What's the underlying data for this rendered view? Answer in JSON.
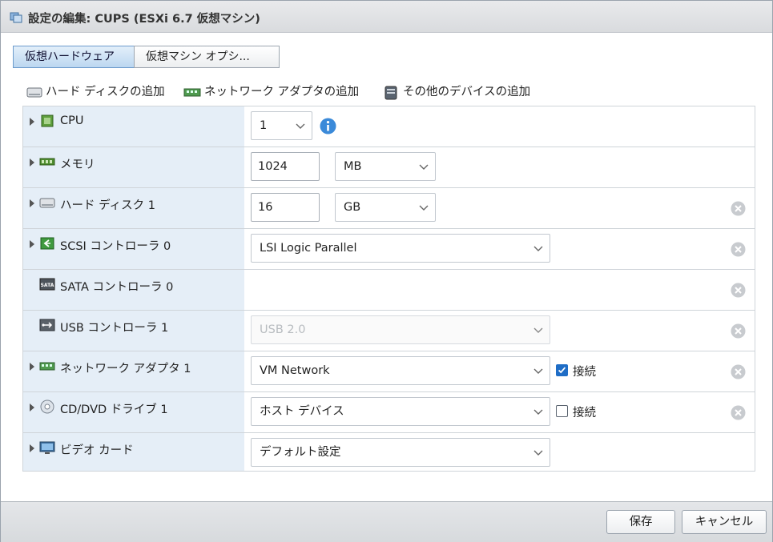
{
  "dialog": {
    "title": "設定の編集: CUPS (ESXi 6.7 仮想マシン)"
  },
  "tabs": [
    {
      "label": "仮想ハードウェア"
    },
    {
      "label": "仮想マシン オプシ..."
    }
  ],
  "toolbar": {
    "add_disk": "ハード ディスクの追加",
    "add_network": "ネットワーク アダプタの追加",
    "add_other": "その他のデバイスの追加"
  },
  "rows": {
    "cpu": {
      "label": "CPU",
      "value": "1"
    },
    "memory": {
      "label": "メモリ",
      "value": "1024",
      "unit": "MB"
    },
    "disk": {
      "label": "ハード ディスク 1",
      "value": "16",
      "unit": "GB"
    },
    "scsi": {
      "label": "SCSI コントローラ 0",
      "value": "LSI Logic Parallel"
    },
    "sata": {
      "label": "SATA コントローラ 0"
    },
    "usb": {
      "label": "USB コントローラ 1",
      "value": "USB 2.0"
    },
    "network": {
      "label": "ネットワーク アダプタ 1",
      "value": "VM Network",
      "connect_label": "接続",
      "connected": true
    },
    "cddvd": {
      "label": "CD/DVD ドライブ 1",
      "value": "ホスト デバイス",
      "connect_label": "接続",
      "connected": false
    },
    "video": {
      "label": "ビデオ カード",
      "value": "デフォルト設定"
    }
  },
  "footer": {
    "save": "保存",
    "cancel": "キャンセル"
  },
  "colors": {
    "accent": "#1f6dc6",
    "left_column": "#e5eef7",
    "info": "#3b8ad9"
  }
}
